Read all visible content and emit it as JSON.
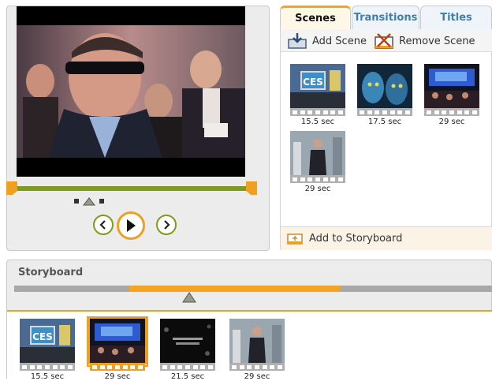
{
  "tabs": [
    {
      "label": "Scenes",
      "active": true
    },
    {
      "label": "Transitions",
      "active": false
    },
    {
      "label": "Titles",
      "active": false
    }
  ],
  "toolbar": {
    "add_scene_label": "Add Scene",
    "remove_scene_label": "Remove Scene"
  },
  "scenes": [
    {
      "duration": "15.5 sec",
      "thumb": "ces-sign"
    },
    {
      "duration": "17.5 sec",
      "thumb": "avatar"
    },
    {
      "duration": "29 sec",
      "thumb": "expo-hall"
    },
    {
      "duration": "29 sec",
      "thumb": "presenter"
    }
  ],
  "add_to_storyboard_label": "Add to Storyboard",
  "storyboard": {
    "title": "Storyboard",
    "clips": [
      {
        "duration": "15.5 sec",
        "thumb": "ces-sign",
        "selected": false
      },
      {
        "duration": "29 sec",
        "thumb": "expo-hall",
        "selected": true
      },
      {
        "duration": "21.5 sec",
        "thumb": "dark-text",
        "selected": false
      },
      {
        "duration": "29 sec",
        "thumb": "presenter",
        "selected": false
      }
    ]
  },
  "colors": {
    "accent_orange": "#f0a020",
    "accent_green": "#7f9b1a",
    "tab_text_blue": "#3f7fae"
  }
}
